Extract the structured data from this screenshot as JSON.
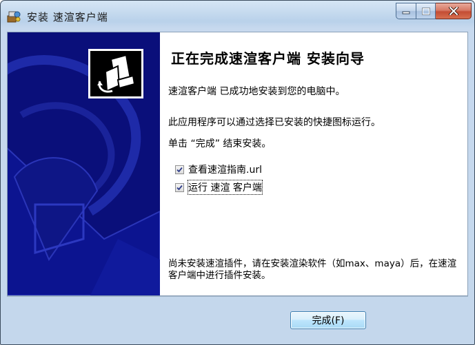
{
  "window": {
    "title": "安装 速渲客户端",
    "caption": {
      "minimize": "—",
      "maximize": "□",
      "close": "✕"
    }
  },
  "wizard": {
    "heading": "正在完成速渲客户端 安装向导",
    "installed_msg": "速渲客户端 已成功地安装到您的电脑中。",
    "shortcut_msg": "此应用程序可以通过选择已安装的快捷图标运行。",
    "finish_msg": "单击 “完成” 结束安装。",
    "options": [
      {
        "label": "查看速渲指南.url",
        "checked": true
      },
      {
        "label": "运行 速渲 客户端",
        "checked": true
      }
    ],
    "plugin_note": "尚未安装速渲插件，请在安装渲染软件（如max、maya）后，在速渲客户端中进行插件安装。"
  },
  "buttons": {
    "finish": "完成(F)"
  },
  "colors": {
    "side_panel": "#0a0f7a",
    "titlebar": "#b9d1ea",
    "close_button": "#c44d34"
  }
}
